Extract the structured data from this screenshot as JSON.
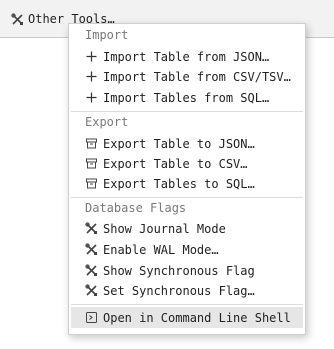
{
  "toolbar": {
    "other_tools_label": "Other Tools…"
  },
  "menu": {
    "import": {
      "heading": "Import",
      "items": [
        "Import Table from JSON…",
        "Import Table from CSV/TSV…",
        "Import Tables from SQL…"
      ]
    },
    "export": {
      "heading": "Export",
      "items": [
        "Export Table to JSON…",
        "Export Table to CSV…",
        "Export Tables to SQL…"
      ]
    },
    "flags": {
      "heading": "Database Flags",
      "items": [
        "Show Journal Mode",
        "Enable WAL Mode…",
        "Show Synchronous Flag",
        "Set Synchronous Flag…"
      ]
    },
    "shell": {
      "label": "Open in Command Line Shell"
    }
  }
}
